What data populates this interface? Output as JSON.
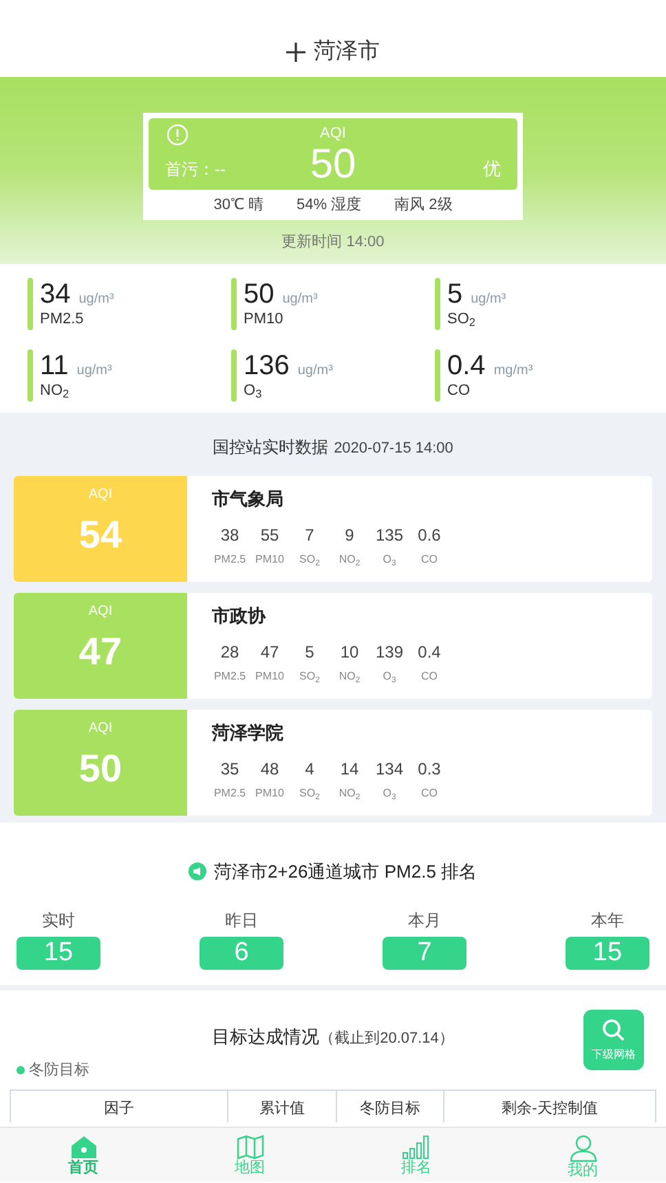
{
  "header": {
    "title": "菏泽市"
  },
  "aqi_card": {
    "label": "AQI",
    "value": "50",
    "primary_pollutant": "首污：--",
    "grade": "优",
    "weather": [
      "30℃ 晴",
      "54% 湿度",
      "南风 2级"
    ],
    "update_time": "更新时间 14:00"
  },
  "pollutants": [
    {
      "value": "34",
      "unit": "ug/m³",
      "name": "PM2.5"
    },
    {
      "value": "50",
      "unit": "ug/m³",
      "name": "PM10"
    },
    {
      "value": "5",
      "unit": "ug/m³",
      "name": "SO$_{2}$"
    },
    {
      "value": "11",
      "unit": "ug/m³",
      "name": "NO$_{2}$"
    },
    {
      "value": "136",
      "unit": "ug/m³",
      "name": "O$_{3}$"
    },
    {
      "value": "0.4",
      "unit": "mg/m³",
      "name": "CO"
    }
  ],
  "stations": {
    "title": "国控站实时数据",
    "time": "2020-07-15 14:00",
    "items": [
      {
        "aqi_label": "AQI",
        "aqi": "54",
        "color": "#fdd84e",
        "name": "市气象局",
        "readings": [
          {
            "value": "38",
            "label": "PM2.5"
          },
          {
            "value": "55",
            "label": "PM10"
          },
          {
            "value": "7",
            "label": "SO$_{2}$"
          },
          {
            "value": "9",
            "label": "NO$_{2}$"
          },
          {
            "value": "135",
            "label": "O$_{3}$"
          },
          {
            "value": "0.6",
            "label": "CO"
          }
        ]
      },
      {
        "aqi_label": "AQI",
        "aqi": "47",
        "color": "#a8e05f",
        "name": "市政协",
        "readings": [
          {
            "value": "28",
            "label": "PM2.5"
          },
          {
            "value": "47",
            "label": "PM10"
          },
          {
            "value": "5",
            "label": "SO$_{2}$"
          },
          {
            "value": "10",
            "label": "NO$_{2}$"
          },
          {
            "value": "139",
            "label": "O$_{3}$"
          },
          {
            "value": "0.4",
            "label": "CO"
          }
        ]
      },
      {
        "aqi_label": "AQI",
        "aqi": "50",
        "color": "#a8e05f",
        "name": "菏泽学院",
        "readings": [
          {
            "value": "35",
            "label": "PM2.5"
          },
          {
            "value": "48",
            "label": "PM10"
          },
          {
            "value": "4",
            "label": "SO$_{2}$"
          },
          {
            "value": "14",
            "label": "NO$_{2}$"
          },
          {
            "value": "134",
            "label": "O$_{3}$"
          },
          {
            "value": "0.3",
            "label": "CO"
          }
        ]
      }
    ]
  },
  "ranking": {
    "title": "菏泽市2+26通道城市 PM2.5 排名",
    "items": [
      {
        "period": "实时",
        "rank": "15"
      },
      {
        "period": "昨日",
        "rank": "6"
      },
      {
        "period": "本月",
        "rank": "7"
      },
      {
        "period": "本年",
        "rank": "15"
      }
    ]
  },
  "target": {
    "title": "目标达成情况",
    "note": "（截止到20.07.14）",
    "button": "下级网格",
    "legend": "冬防目标",
    "columns": [
      "因子",
      "累计值",
      "冬防目标",
      "剩余-天控制值"
    ]
  },
  "nav": [
    {
      "kind": "home",
      "label": "首页",
      "selected": true
    },
    {
      "kind": "map",
      "label": "地图",
      "selected": false
    },
    {
      "kind": "rank",
      "label": "排名",
      "selected": false
    },
    {
      "kind": "me",
      "label": "我的",
      "selected": false
    }
  ]
}
